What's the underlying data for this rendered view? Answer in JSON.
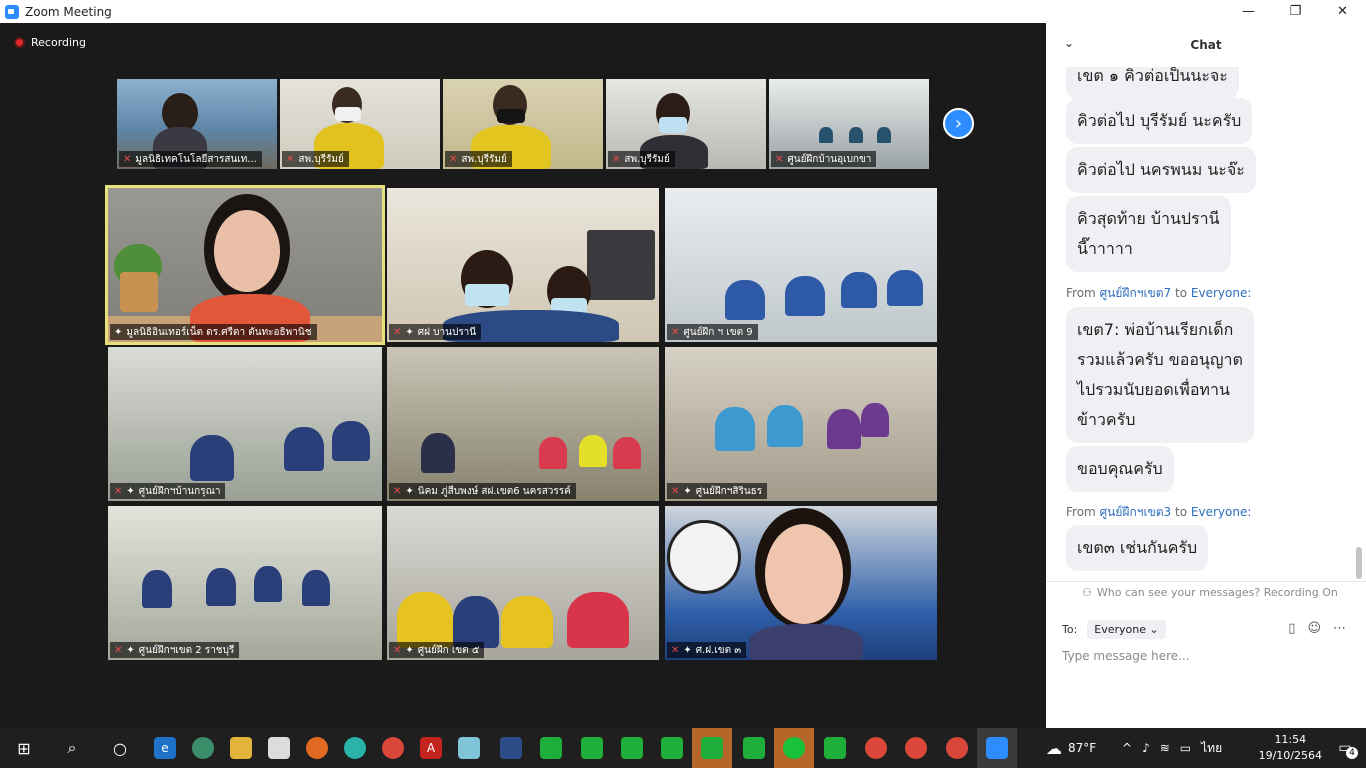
{
  "window": {
    "title": "Zoom Meeting",
    "minimize": "—",
    "maximize": "❐",
    "close": "✕"
  },
  "recording": {
    "label": "Recording"
  },
  "thumbnails": [
    {
      "name": "มูลนิธิเทคโนโลยีสารสนเท...",
      "bg": "#6e8aa6"
    },
    {
      "name": "สพ.บุรีรัมย์",
      "bg": "#c9c4b4"
    },
    {
      "name": "สพ.บุรีรัมย์",
      "bg": "#c4b98e"
    },
    {
      "name": "สพ.บุรีรัมย์",
      "bg": "#b8b8b4"
    },
    {
      "name": "ศูนย์ฝึกบ้านอุเบกขา",
      "bg": "#a6aeb0"
    }
  ],
  "tiles": [
    {
      "name": "มูลนิธิอินเทอร์เน็ต ดร.ศรีดา ตันทะอธิพานิช",
      "bg": "#8f8c86"
    },
    {
      "name": "ศฝ บานปรานี",
      "bg": "#bdb6a4"
    },
    {
      "name": "ศูนย์ฝึก ฯ เขต 9",
      "bg": "#aab4bc"
    },
    {
      "name": "ศูนย์ฝึกฯบ้านกรุณา",
      "bg": "#9ea49a"
    },
    {
      "name": "นิคม ภู่สืบพงษ์ สฝ.เขต6 นครสวรรค์",
      "bg": "#8a8778"
    },
    {
      "name": "ศูนย์ฝึกฯสิรินธร",
      "bg": "#b6aea0"
    },
    {
      "name": "ศูนย์ฝึกฯเขต 2 ราชบุรี",
      "bg": "#b3b6ac"
    },
    {
      "name": "ศูนย์ฝึก เขต ๕",
      "bg": "#a8a89c"
    },
    {
      "name": "ศ.ฝ.เขต ๓",
      "bg": "#5c7a9a"
    }
  ],
  "chat": {
    "title": "Chat",
    "collapse_icon": "⌄",
    "messages": [
      "เขต ๑ คิวต่อเป็นนะจะ",
      "คิวต่อไป บุรีรัมย์ นะครับ",
      "คิวต่อไป นครพนม นะจ๊ะ",
      "คิวสุดท้าย บ้านปรานี",
      "นี๊าาาาา",
      "เขต7: พ่อบ้านเรียกเด็ก",
      "รวมแล้วครับ ขออนุญาต",
      "ไปรวมนับยอดเพื่อทาน",
      "ข้าวครับ",
      "ขอบคุณครับ",
      "เขต๓ เช่นกันครับ"
    ],
    "from1": {
      "prefix": "From",
      "sender": "ศูนย์ฝึกฯเขต7",
      "to": "to",
      "recipient": "Everyone:"
    },
    "from2": {
      "prefix": "From",
      "sender": "ศูนย์ฝึกฯเขต3",
      "to": "to",
      "recipient": "Everyone:"
    },
    "who_can_see": "Who can see your messages? Recording On",
    "to_label": "To:",
    "to_value": "Everyone",
    "placeholder": "Type message here..."
  },
  "taskbar": {
    "weather": "87°F",
    "time": "11:54",
    "date": "19/10/2564",
    "lang": "ไทย",
    "notifications": "4"
  }
}
